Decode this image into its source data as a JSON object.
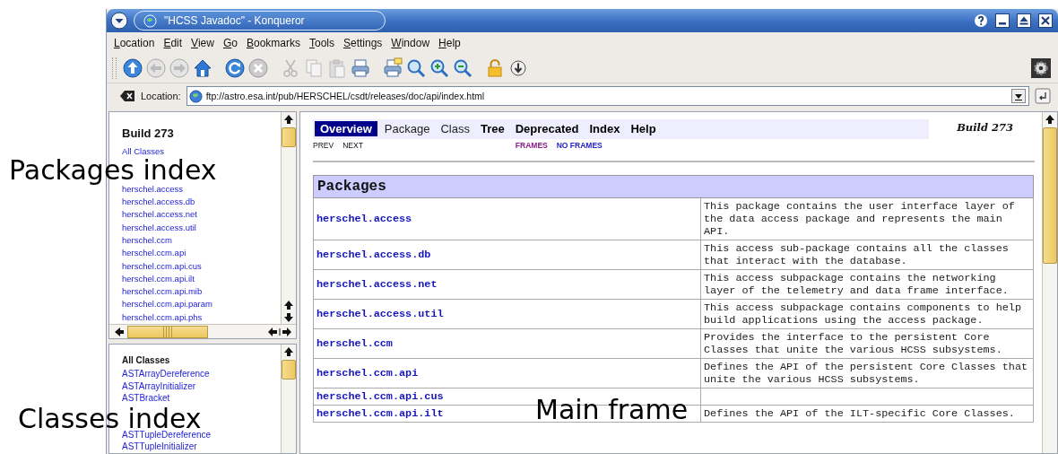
{
  "window": {
    "title": "\"HCSS Javadoc\" - Konqueror"
  },
  "menu": [
    "Location",
    "Edit",
    "View",
    "Go",
    "Bookmarks",
    "Tools",
    "Settings",
    "Window",
    "Help"
  ],
  "location_bar": {
    "label": "Location:",
    "value": "ftp://astro.esa.int/pub/HERSCHEL/csdt/releases/doc/api/index.html"
  },
  "packages_frame": {
    "title": "Build 273",
    "link": "All Classes",
    "items": [
      "herschel.access",
      "herschel.access.db",
      "herschel.access.net",
      "herschel.access.util",
      "herschel.ccm",
      "herschel.ccm.api",
      "herschel.ccm.api.cus",
      "herschel.ccm.api.ilt",
      "herschel.ccm.api.mib",
      "herschel.ccm.api.param",
      "herschel.ccm.api.phs"
    ]
  },
  "classes_frame": {
    "heading": "All Classes",
    "items": [
      "ASTArrayDereference",
      "ASTArrayInitializer",
      "ASTBracket",
      "ASTTupleDereference",
      "ASTTupleInitializer"
    ]
  },
  "main_frame": {
    "nav": [
      {
        "label": "Overview",
        "selected": true,
        "enabled": true
      },
      {
        "label": "Package",
        "selected": false,
        "enabled": false
      },
      {
        "label": "Class",
        "selected": false,
        "enabled": false
      },
      {
        "label": "Tree",
        "selected": false,
        "enabled": true
      },
      {
        "label": "Deprecated",
        "selected": false,
        "enabled": true
      },
      {
        "label": "Index",
        "selected": false,
        "enabled": true
      },
      {
        "label": "Help",
        "selected": false,
        "enabled": true
      }
    ],
    "build": "Build 273",
    "sub_nav": [
      "PREV",
      "NEXT"
    ],
    "frame_links": [
      {
        "label": "FRAMES",
        "visited": true
      },
      {
        "label": "NO FRAMES",
        "visited": false
      }
    ],
    "table": {
      "heading": "Packages",
      "rows": [
        {
          "name": "herschel.access",
          "description": "This package contains the user interface layer of the data access package and represents the main API."
        },
        {
          "name": "herschel.access.db",
          "description": "This access sub-package contains all the classes that interact with the database."
        },
        {
          "name": "herschel.access.net",
          "description": "This access subpackage contains the networking layer of the telemetry and data frame interface."
        },
        {
          "name": "herschel.access.util",
          "description": "This access subpackage contains components to help build applications using the access package."
        },
        {
          "name": "herschel.ccm",
          "description": "Provides the interface to the persistent Core Classes that unite the various HCSS subsystems."
        },
        {
          "name": "herschel.ccm.api",
          "description": "Defines the API of the persistent Core Classes that unite the various HCSS subsystems."
        },
        {
          "name": "herschel.ccm.api.cus"
        },
        {
          "name": "herschel.ccm.api.ilt",
          "description": "Defines the API of the ILT-specific Core Classes."
        }
      ]
    }
  },
  "annotations": [
    {
      "kind": "packages",
      "text": "Packages index"
    },
    {
      "kind": "classes",
      "text": "Classes index"
    },
    {
      "kind": "main",
      "text": "Main frame"
    }
  ]
}
